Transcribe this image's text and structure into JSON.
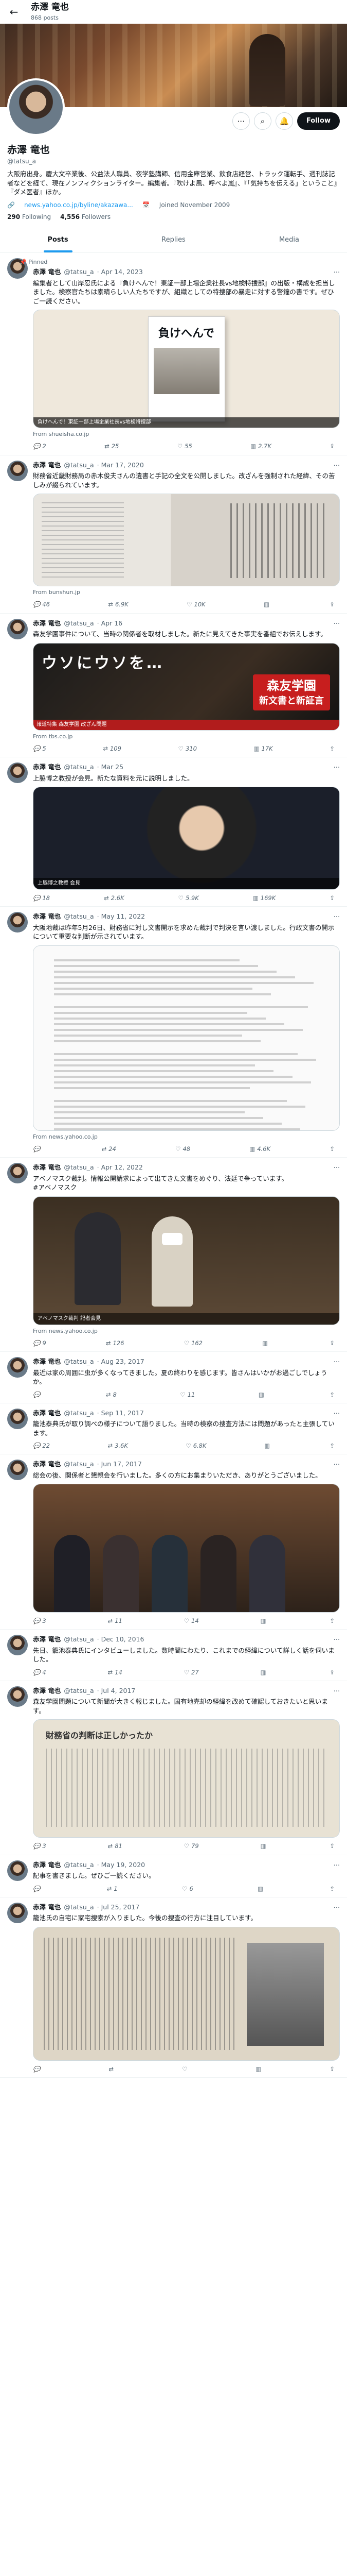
{
  "header": {
    "name": "赤澤 竜也",
    "post_count": "868 posts"
  },
  "profile": {
    "name": "赤澤 竜也",
    "handle": "@tatsu_a",
    "follow_label": "Follow",
    "bio": "大阪府出身。慶大文卒業後、公益法人職員、夜学塾講師、信用金庫営業、飲食店経営、トラック運転手、週刊誌記者などを経て、現在ノンフィクションライター。編集者。『吹けよ風、呼べよ嵐』、『「気持ちを伝える」ということ』『ダメ医者』ほか。",
    "link": "news.yahoo.co.jp/byline/akazawa...",
    "joined": "Joined November 2009",
    "following_count": "290",
    "following_label": "Following",
    "followers_count": "4,556",
    "followers_label": "Followers"
  },
  "tabs": [
    "Posts",
    "Replies",
    "Media"
  ],
  "tweets": [
    {
      "pinned": "Pinned",
      "name": "赤澤 竜也",
      "handle": "@tatsu_a",
      "date": "· Apr 14, 2023",
      "text": "編集者として山岸忍氏による『負けへんで！東証一部上場企業社長vs地検特捜部』の出版・構成を担当しました。検察官たちは素晴らしい人たちですが、組織としての特捜部の暴走に対する警鐘の書です。ぜひご一読ください。",
      "media_caption": "負けへんで！東証一部上場企業社長vs地検特捜部",
      "source": "From shueisha.co.jp",
      "stats": {
        "reply": "2",
        "repost": "25",
        "like": "55",
        "views": "2.7K"
      }
    },
    {
      "name": "赤澤 竜也",
      "handle": "@tatsu_a",
      "date": "· Mar 17, 2020",
      "text": "財務省近畿財務局の赤木俊夫さんの遺書と手記の全文を公開しました。改ざんを強制された経緯、その苦しみが綴られています。",
      "source": "From bunshun.jp",
      "stats": {
        "reply": "46",
        "repost": "6.9K",
        "like": "10K",
        "views": ""
      }
    },
    {
      "name": "赤澤 竜也",
      "handle": "@tatsu_a",
      "date": "· Apr 16",
      "text": "森友学園事件について、当時の関係者を取材しました。新たに見えてきた事実を番組でお伝えします。",
      "media_big": "ウソにウソを…",
      "media_box_top": "森友学園",
      "media_box_bottom": "新文書と新証言",
      "media_bar": "報道特集 森友学園 改ざん問題",
      "source": "From tbs.co.jp",
      "stats": {
        "reply": "5",
        "repost": "109",
        "like": "310",
        "views": "17K"
      }
    },
    {
      "name": "赤澤 竜也",
      "handle": "@tatsu_a",
      "date": "· Mar 25",
      "text": "上脇博之教授が会見。新たな資料を元に説明しました。",
      "media_caption": "上脇博之教授 会見",
      "source": "",
      "stats": {
        "reply": "18",
        "repost": "2.6K",
        "like": "5.9K",
        "views": "169K"
      }
    },
    {
      "name": "赤澤 竜也",
      "handle": "@tatsu_a",
      "date": "· May 11, 2022",
      "text": "大阪地裁は昨年5月26日、財務省に対し文書開示を求めた裁判で判決を言い渡しました。行政文書の開示について重要な判断が示されています。",
      "source": "From news.yahoo.co.jp",
      "stats": {
        "reply": "",
        "repost": "24",
        "like": "48",
        "views": "4.6K"
      }
    },
    {
      "name": "赤澤 竜也",
      "handle": "@tatsu_a",
      "date": "· Apr 12, 2022",
      "text": "アベノマスク裁判。情報公開請求によって出てきた文書をめぐり、法廷で争っています。\n#アベノマスク",
      "media_caption": "アベノマスク裁判 記者会見",
      "source": "From news.yahoo.co.jp",
      "stats": {
        "reply": "9",
        "repost": "126",
        "like": "162",
        "views": ""
      }
    },
    {
      "name": "赤澤 竜也",
      "handle": "@tatsu_a",
      "date": "· Aug 23, 2017",
      "text": "最近は家の周囲に虫が多くなってきました。夏の終わりを感じます。皆さんはいかがお過ごしでしょうか。",
      "source": "",
      "stats": {
        "reply": "",
        "repost": "8",
        "like": "11",
        "views": ""
      }
    },
    {
      "name": "赤澤 竜也",
      "handle": "@tatsu_a",
      "date": "· Sep 11, 2017",
      "text": "籠池泰典氏が取り調べの様子について語りました。当時の検察の捜査方法には問題があったと主張しています。",
      "source": "",
      "stats": {
        "reply": "22",
        "repost": "3.6K",
        "like": "6.8K",
        "views": ""
      }
    },
    {
      "name": "赤澤 竜也",
      "handle": "@tatsu_a",
      "date": "· Jun 17, 2017",
      "text": "総会の後、関係者と懇親会を行いました。多くの方にお集まりいただき、ありがとうございました。",
      "source": "",
      "stats": {
        "reply": "3",
        "repost": "11",
        "like": "14",
        "views": ""
      }
    },
    {
      "name": "赤澤 竜也",
      "handle": "@tatsu_a",
      "date": "· Dec 10, 2016",
      "text": "先日、籠池泰典氏にインタビューしました。数時間にわたり、これまでの経緯について詳しく話を伺いました。",
      "source": "",
      "stats": {
        "reply": "4",
        "repost": "14",
        "like": "27",
        "views": ""
      }
    },
    {
      "name": "赤澤 竜也",
      "handle": "@tatsu_a",
      "date": "· Jul 4, 2017",
      "text": "森友学園問題について新聞が大きく報じました。国有地売却の経緯を改めて確認しておきたいと思います。",
      "media_head": "財務省の判断は正しかったか",
      "source": "",
      "stats": {
        "reply": "3",
        "repost": "81",
        "like": "79",
        "views": ""
      }
    },
    {
      "name": "赤澤 竜也",
      "handle": "@tatsu_a",
      "date": "· May 19, 2020",
      "text": "記事を書きました。ぜひご一読ください。",
      "source": "",
      "stats": {
        "reply": "",
        "repost": "1",
        "like": "6",
        "views": ""
      }
    },
    {
      "name": "赤澤 竜也",
      "handle": "@tatsu_a",
      "date": "· Jul 25, 2017",
      "text": "籠池氏の自宅に家宅捜索が入りました。今後の捜査の行方に注目しています。",
      "source": "",
      "stats": {
        "reply": "",
        "repost": "",
        "like": "",
        "views": ""
      }
    }
  ]
}
